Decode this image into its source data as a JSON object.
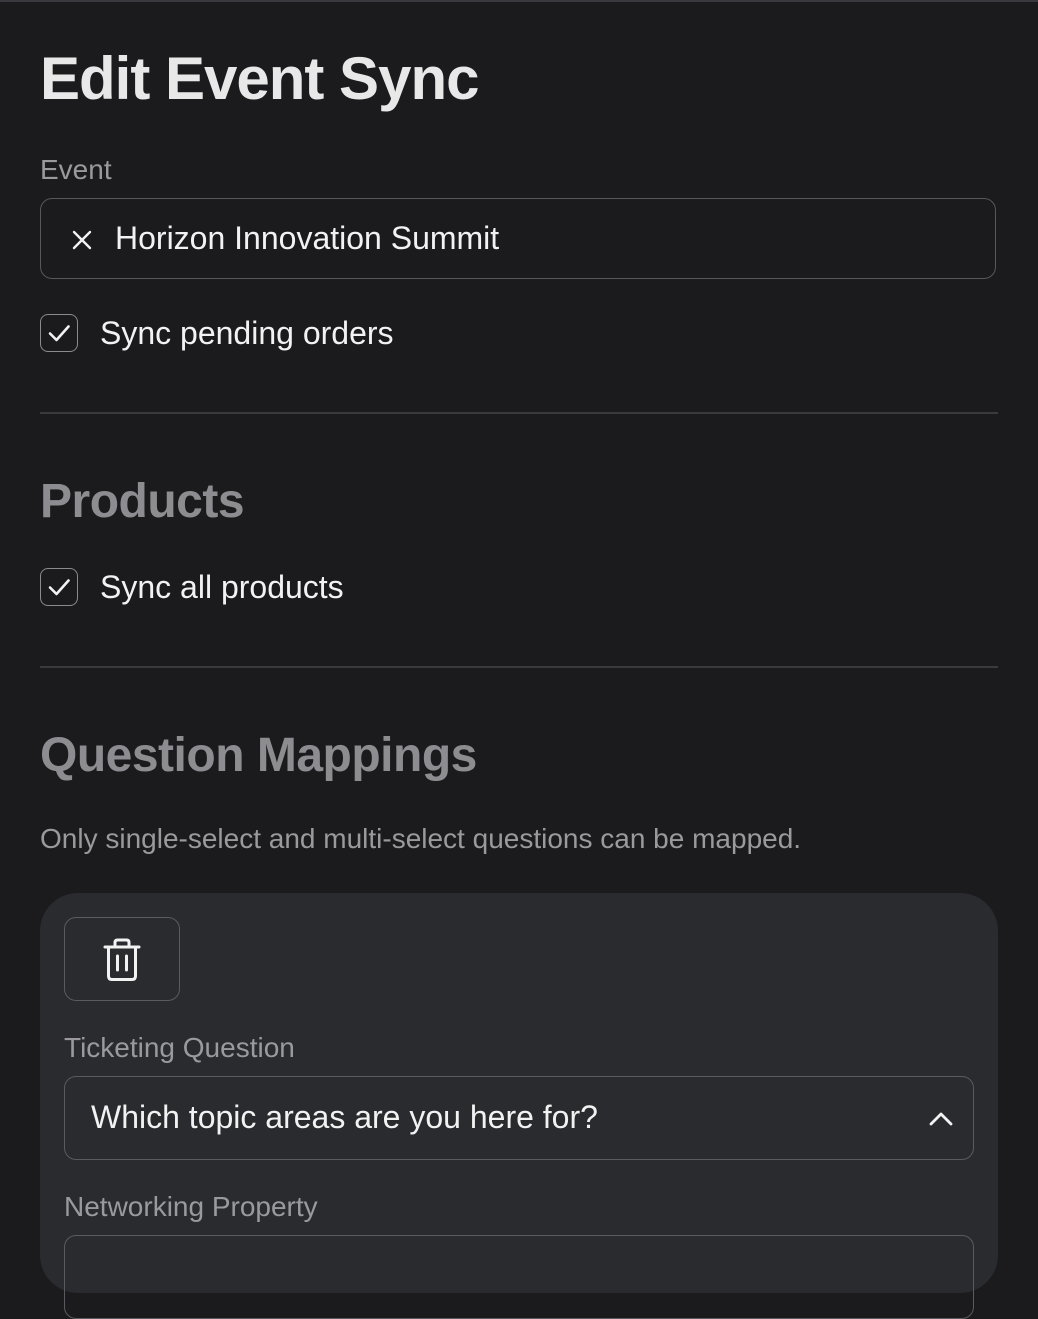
{
  "page": {
    "title": "Edit Event Sync"
  },
  "event": {
    "label": "Event",
    "selected_value": "Horizon Innovation Summit",
    "remove_icon": "close-icon"
  },
  "sync_pending": {
    "label": "Sync pending orders",
    "checked": true
  },
  "products": {
    "title": "Products",
    "sync_all": {
      "label": "Sync all products",
      "checked": true
    }
  },
  "question_mappings": {
    "title": "Question Mappings",
    "helper": "Only single-select and multi-select questions can be mapped.",
    "mappings": [
      {
        "delete_icon": "trash-icon",
        "ticketing_question_label": "Ticketing Question",
        "ticketing_question_value": "Which topic areas are you here for?",
        "networking_property_label": "Networking Property"
      }
    ]
  },
  "colors": {
    "background": "#1b1b1d",
    "card": "#2a2b2f",
    "border": "#57575c",
    "text": "#f2f2f2",
    "muted": "#9a9a9e",
    "section_title": "#8d8d91"
  }
}
